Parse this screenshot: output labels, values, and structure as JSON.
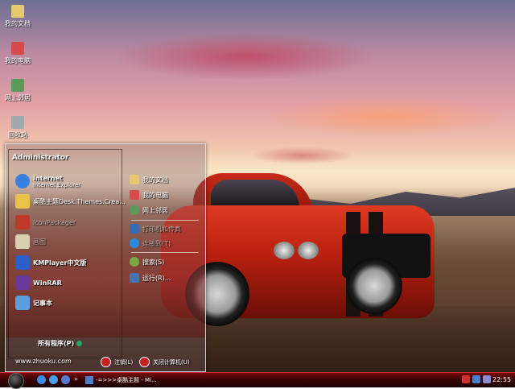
{
  "desktop_icons": [
    {
      "label": "我的文档",
      "color": "#e6c870"
    },
    {
      "label": "我的电脑",
      "color": "#d64a4a"
    },
    {
      "label": "网上邻居",
      "color": "#5a9a5a"
    },
    {
      "label": "回收站",
      "color": "#a0a8b0"
    }
  ],
  "start_menu": {
    "user": "Administrator",
    "pinned": [
      {
        "title": "Internet",
        "subtitle": "Internet Explorer",
        "icon": "ie-icon",
        "color": "#3a7fe0"
      },
      {
        "title": "桌酷主题Desk.Themes.Crea...",
        "subtitle": "",
        "icon": "theme-icon",
        "color": "#e9c24a"
      }
    ],
    "programs": [
      {
        "title": "IconPackager",
        "icon": "iconpackager-icon",
        "color": "#c03a2a",
        "faded": true
      },
      {
        "title": "画图",
        "icon": "paint-icon",
        "color": "#d8d0b0",
        "faded": true
      },
      {
        "title": "KMPlayer中文版",
        "icon": "kmplayer-icon",
        "color": "#2a5ec8",
        "faded": false
      },
      {
        "title": "WinRAR",
        "icon": "winrar-icon",
        "color": "#6a3a9a",
        "faded": false
      },
      {
        "title": "记事本",
        "icon": "notepad-icon",
        "color": "#5aa0e0",
        "faded": false
      }
    ],
    "all_programs": "所有程序(P)",
    "url": "www.zhuoku.com",
    "right": [
      {
        "label": "我的文档",
        "icon": "documents-icon",
        "color": "#e6c870",
        "faded": false
      },
      {
        "label": "我的电脑",
        "icon": "computer-icon",
        "color": "#d64a4a",
        "faded": false
      },
      {
        "label": "网上邻居",
        "icon": "network-icon",
        "color": "#5a9a5a",
        "faded": false
      },
      {
        "label": "打印机和传真",
        "icon": "printer-icon",
        "color": "#3a6ab0",
        "faded": true
      },
      {
        "label": "连接到(T)",
        "icon": "connect-icon",
        "color": "#2a8ae0",
        "faded": true
      },
      {
        "label": "搜索(S)",
        "icon": "search-icon",
        "color": "#7aaa40",
        "faded": false
      },
      {
        "label": "运行(R)...",
        "icon": "run-icon",
        "color": "#4a70b0",
        "faded": false
      }
    ],
    "logoff": "注销(L)",
    "shutdown": "关闭计算机(U)"
  },
  "taskbar": {
    "separator": "»",
    "task_label": "-=>>>桌酷主题 - Mi...",
    "clock": "22:55"
  }
}
